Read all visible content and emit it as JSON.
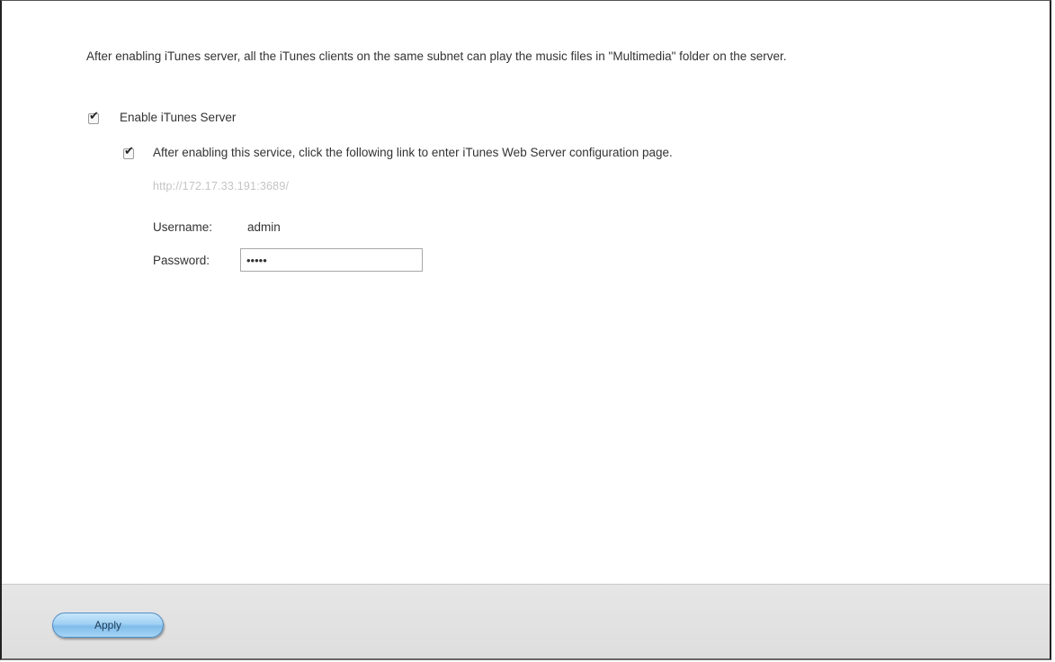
{
  "description": {
    "text": "After enabling iTunes server, all the iTunes clients on the same subnet can play the music files in \"Multimedia\" folder on the server."
  },
  "enable_itunes": {
    "label": "Enable iTunes Server",
    "checked": true,
    "check_glyph": "✔"
  },
  "web_config": {
    "label": "After enabling this service, click the following link to enter iTunes Web Server configuration page.",
    "checked": true,
    "check_glyph": "✔",
    "link_text": "http://172.17.33.191:3689/"
  },
  "credentials": {
    "username_label": "Username:",
    "username_value": "admin",
    "password_label": "Password:",
    "password_value": "•••••"
  },
  "footer": {
    "apply_label": "Apply"
  },
  "colors": {
    "link_disabled": "#c4c4c4",
    "apply_accent": "#7fbcea"
  }
}
